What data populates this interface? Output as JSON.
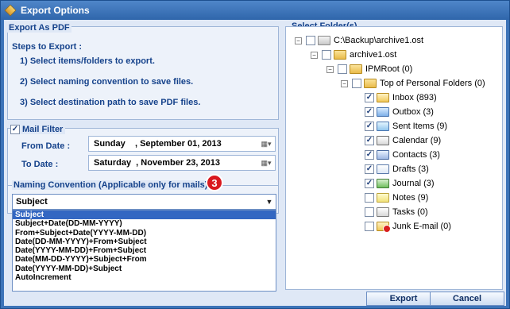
{
  "window": {
    "title": "Export Options"
  },
  "pdf_section": {
    "label": "Export As PDF",
    "steps_title": "Steps to Export :",
    "steps": [
      "1) Select items/folders to export.",
      "2) Select naming convention to save files.",
      "3) Select destination path to save PDF files."
    ]
  },
  "filter": {
    "label": "Mail Filter",
    "checked": true,
    "from_label": "From Date :",
    "from_value": "Sunday    , September 01, 2013",
    "to_label": "To Date :",
    "to_value": "Saturday  , November 23, 2013"
  },
  "naming": {
    "label": "Naming Convention (Applicable only for mails)",
    "badge": "3",
    "selected": "Subject",
    "options": [
      "Subject",
      "Subject+Date(DD-MM-YYYY)",
      "From+Subject+Date(YYYY-MM-DD)",
      "Date(DD-MM-YYYY)+From+Subject",
      "Date(YYYY-MM-DD)+From+Subject",
      "Date(MM-DD-YYYY)+Subject+From",
      "Date(YYYY-MM-DD)+Subject",
      "AutoIncrement"
    ]
  },
  "folders": {
    "label": "Select Folder(s)",
    "items": [
      {
        "label": "C:\\Backup\\archive1.ost",
        "checked": false,
        "expander": "-"
      },
      {
        "label": "archive1.ost",
        "checked": false,
        "expander": "-"
      },
      {
        "label": "IPMRoot (0)",
        "checked": false,
        "expander": "-"
      },
      {
        "label": "Top of Personal Folders (0)",
        "checked": false,
        "expander": "-"
      },
      {
        "label": "Inbox (893)",
        "checked": true,
        "icon": "inbox-folder-icon"
      },
      {
        "label": "Outbox (3)",
        "checked": true,
        "icon": "outbox-folder-icon"
      },
      {
        "label": "Sent Items (9)",
        "checked": true,
        "icon": "sent-items-folder-icon"
      },
      {
        "label": "Calendar (9)",
        "checked": true,
        "icon": "calendar-folder-icon"
      },
      {
        "label": "Contacts (3)",
        "checked": true,
        "icon": "contacts-folder-icon"
      },
      {
        "label": "Drafts (3)",
        "checked": true,
        "icon": "drafts-folder-icon"
      },
      {
        "label": "Journal (3)",
        "checked": true,
        "icon": "journal-folder-icon"
      },
      {
        "label": "Notes (9)",
        "checked": false,
        "icon": "notes-folder-icon"
      },
      {
        "label": "Tasks (0)",
        "checked": false,
        "icon": "tasks-folder-icon"
      },
      {
        "label": "Junk E-mail (0)",
        "checked": false,
        "icon": "junk-email-folder-icon"
      }
    ]
  },
  "buttons": {
    "export": "Export",
    "cancel": "Cancel"
  }
}
